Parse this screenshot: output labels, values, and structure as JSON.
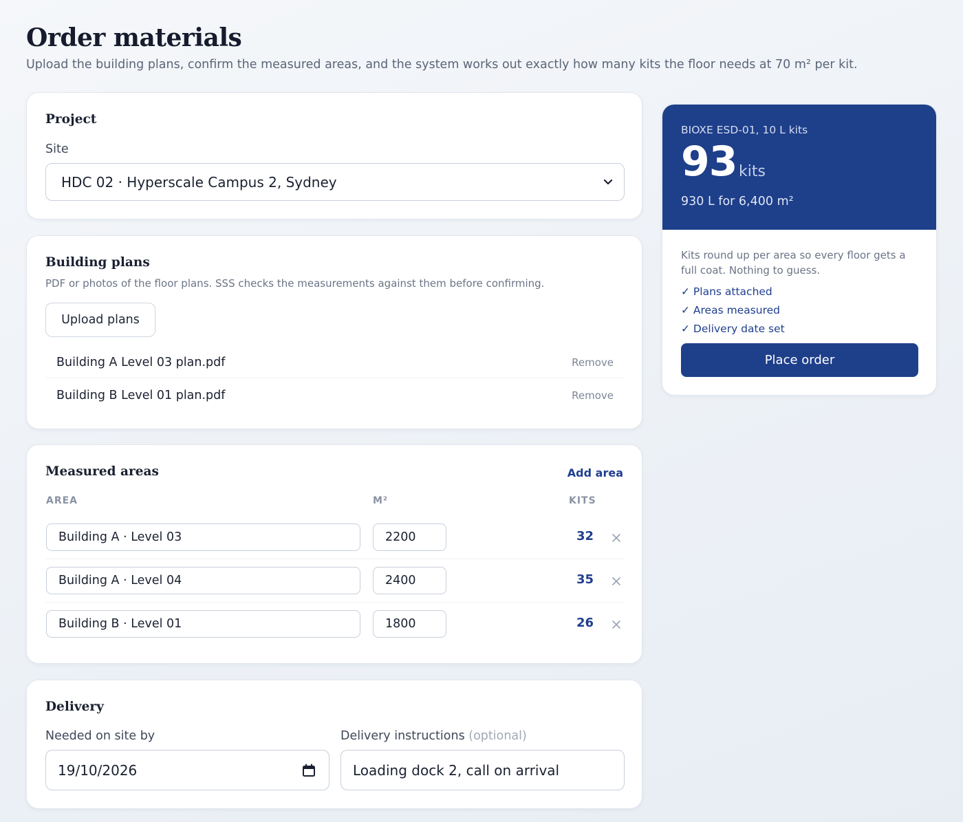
{
  "header": {
    "title": "Order materials",
    "subtitle": "Upload the building plans, confirm the measured areas, and the system works out exactly how many kits the floor needs at 70 m² per kit."
  },
  "project": {
    "title": "Project",
    "site_label": "Site",
    "site_value": "HDC 02 · Hyperscale Campus 2, Sydney"
  },
  "plans": {
    "title": "Building plans",
    "description": "PDF or photos of the floor plans. SSS checks the measurements against them before confirming.",
    "upload_label": "Upload plans",
    "files": [
      {
        "name": "Building A Level 03 plan.pdf",
        "remove_label": "Remove"
      },
      {
        "name": "Building B Level 01 plan.pdf",
        "remove_label": "Remove"
      }
    ]
  },
  "areas": {
    "title": "Measured areas",
    "add_label": "Add area",
    "columns": {
      "area": "AREA",
      "m2": "M²",
      "kits": "KITS"
    },
    "rows": [
      {
        "area": "Building A · Level 03",
        "m2": "2200",
        "kits": "32"
      },
      {
        "area": "Building A · Level 04",
        "m2": "2400",
        "kits": "35"
      },
      {
        "area": "Building B · Level 01",
        "m2": "1800",
        "kits": "26"
      }
    ]
  },
  "delivery": {
    "title": "Delivery",
    "date_label": "Needed on site by",
    "date_value": "19/10/2026",
    "instructions_label": "Delivery instructions",
    "instructions_optional": "(optional)",
    "instructions_value": "Loading dock 2, call on arrival"
  },
  "summary": {
    "product": "BIOXE ESD-01, 10 L kits",
    "total_kits": "93",
    "unit": "kits",
    "volume": "930 L for 6,400 m²",
    "note": "Kits round up per area so every floor gets a full coat. Nothing to guess.",
    "checks": [
      "✓ Plans attached",
      "✓ Areas measured",
      "✓ Delivery date set"
    ],
    "cta": "Place order"
  },
  "colors": {
    "accent": "#1e3f8a",
    "link": "#1f3f8f",
    "muted_text": "#6b7486"
  }
}
